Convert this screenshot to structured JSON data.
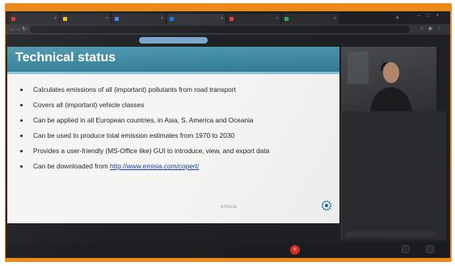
{
  "browser": {
    "tabs": [
      {
        "label": "",
        "favicon_color": "#d93025"
      },
      {
        "label": "",
        "favicon_color": "#fbbc04"
      },
      {
        "label": "",
        "favicon_color": "#4285f4"
      },
      {
        "label": "",
        "favicon_color": "#1a73e8"
      },
      {
        "label": "",
        "favicon_color": "#ea4335"
      },
      {
        "label": "",
        "favicon_color": "#34a853"
      }
    ],
    "url": "",
    "new_tab_icon": "plus-icon"
  },
  "meeting": {
    "presenting_chip": "",
    "participant_name": "",
    "chat": {
      "title": "",
      "messages": [
        {
          "who": "",
          "text": "",
          "time": ""
        },
        {
          "who": "",
          "text": "",
          "time": ""
        },
        {
          "who": "",
          "text": "",
          "time": ""
        },
        {
          "who": "",
          "text": "",
          "time": ""
        },
        {
          "who": "",
          "text": "",
          "time": ""
        },
        {
          "who": "",
          "text": "",
          "time": ""
        },
        {
          "who": "",
          "text": "",
          "time": ""
        }
      ],
      "input_placeholder": ""
    },
    "toolbar": {
      "left_button": "",
      "middle_button": "",
      "right_button": "",
      "leave_icon": "phone-hangup-icon",
      "pill_1": "",
      "pill_2": ""
    }
  },
  "slide": {
    "title": "Technical status",
    "bullets": [
      {
        "text": "Calculates emissions of all (important) pollutants from road transport"
      },
      {
        "text": "Covers all (important) vehicle classes"
      },
      {
        "text": "Can be applied in all European countries, in Asia, S. America and Oceania"
      },
      {
        "text": "Can be used to produce total emission estimates from 1970 to 2030"
      },
      {
        "text": "Provides a user-friendly (MS-Office like) GUI to introduce, view, and export data"
      },
      {
        "text": "Can be downloaded from ",
        "link": "http://www.emisia.com/copert/"
      }
    ],
    "logo_text": "emisia",
    "funding_note": ""
  },
  "colors": {
    "monitor_bezel": "#e98a1a",
    "slide_title_band": "#2f7a93",
    "leave_button": "#d93025",
    "link": "#1a3fa0"
  }
}
